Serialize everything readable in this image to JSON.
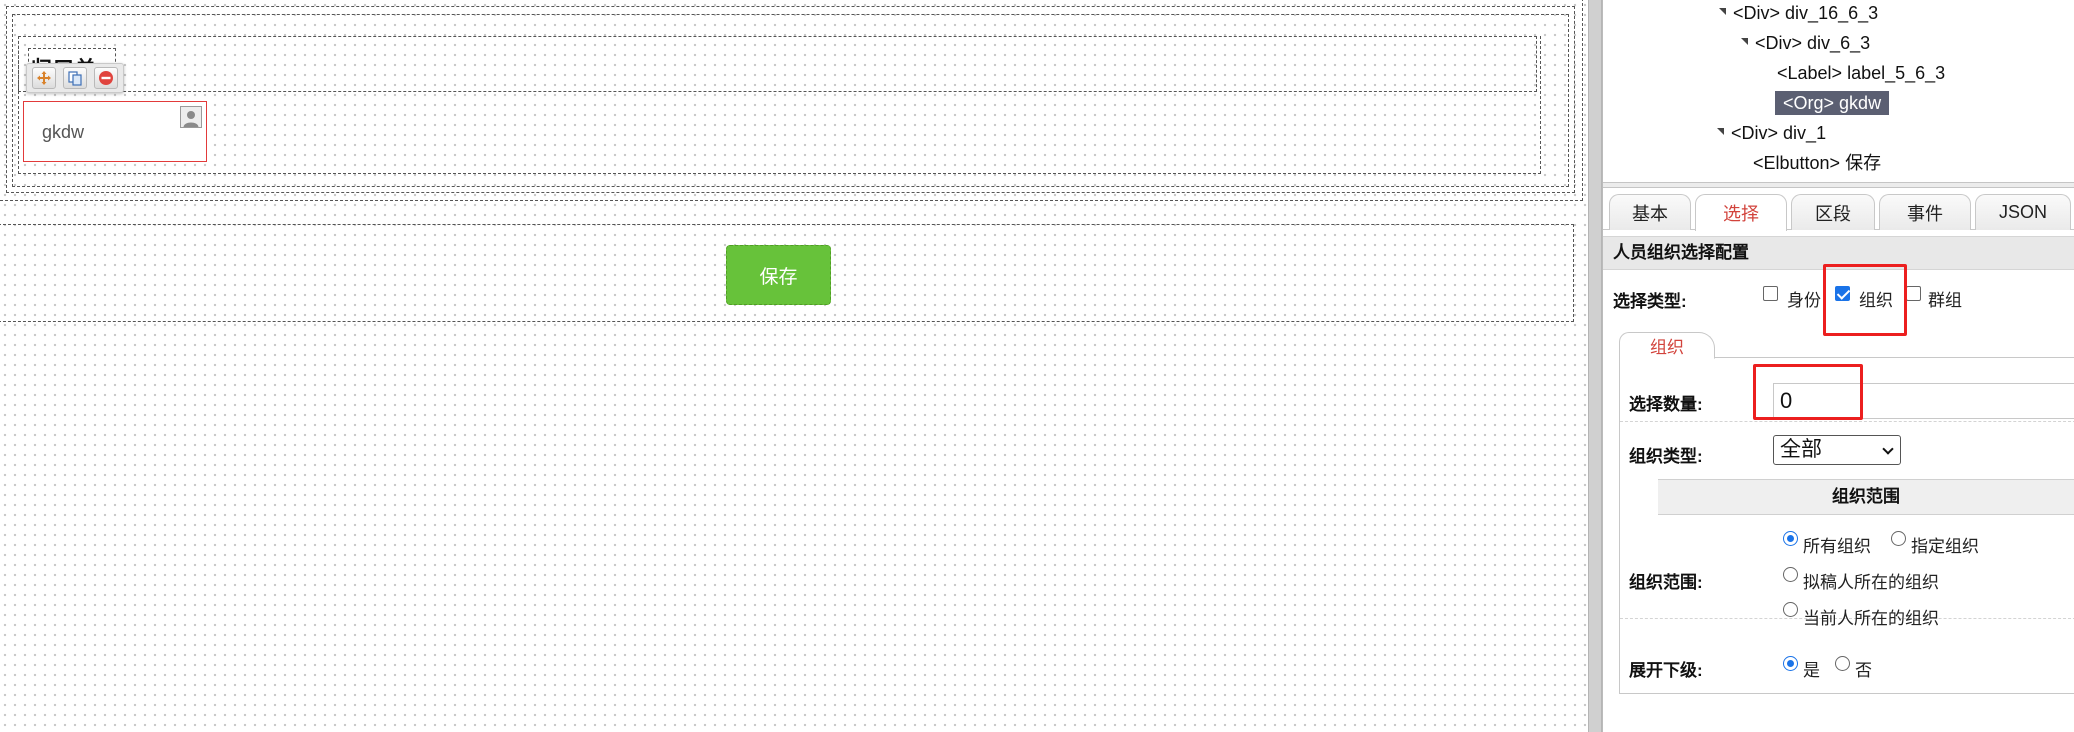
{
  "designer": {
    "field_label": "归口单位",
    "org_field_value": "gkdw",
    "toolbar": {
      "move_icon": "move-icon",
      "copy_icon": "copy-icon",
      "delete_icon": "delete-icon"
    },
    "save_button_label": "保存"
  },
  "tree": {
    "rows": [
      {
        "tag": "<Div>",
        "name": "div_16_6_3"
      },
      {
        "tag": "<Div>",
        "name": "div_6_3"
      },
      {
        "tag": "<Label>",
        "name": "label_5_6_3"
      },
      {
        "tag": "<Org>",
        "name": "gkdw",
        "selected": true
      },
      {
        "tag": "<Div>",
        "name": "div_1"
      },
      {
        "tag": "<Elbutton>",
        "name": "保存"
      }
    ]
  },
  "props": {
    "tabs": [
      "基本",
      "选择",
      "区段",
      "事件",
      "JSON"
    ],
    "active_tab": "选择",
    "section_title": "人员组织选择配置",
    "select_type": {
      "label": "选择类型:",
      "options": [
        {
          "label": "身份",
          "checked": false
        },
        {
          "label": "组织",
          "checked": true
        },
        {
          "label": "群组",
          "checked": false
        }
      ]
    },
    "sub_tab": "组织",
    "select_count": {
      "label": "选择数量:",
      "value": "0"
    },
    "org_type": {
      "label": "组织类型:",
      "value": "全部"
    },
    "org_scope_header": "组织范围",
    "org_scope": {
      "label": "组织范围:",
      "options": [
        {
          "label": "所有组织",
          "checked": true
        },
        {
          "label": "指定组织",
          "checked": false
        },
        {
          "label": "拟稿人所在的组织",
          "checked": false
        },
        {
          "label": "当前人所在的组织",
          "checked": false
        }
      ]
    },
    "expand_sub": {
      "label": "展开下级:",
      "options": [
        {
          "label": "是",
          "checked": true
        },
        {
          "label": "否",
          "checked": false
        }
      ]
    }
  }
}
